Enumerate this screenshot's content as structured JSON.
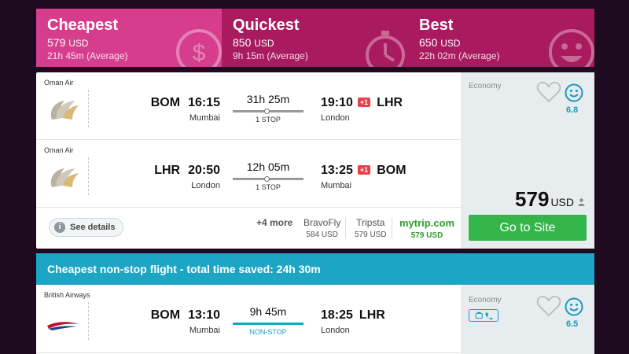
{
  "tabs": [
    {
      "title": "Cheapest",
      "price": "579",
      "currency": "USD",
      "avg": "21h 45m (Average)"
    },
    {
      "title": "Quickest",
      "price": "850",
      "currency": "USD",
      "avg": "9h 15m (Average)"
    },
    {
      "title": "Best",
      "price": "650",
      "currency": "USD",
      "avg": "22h 02m (Average)"
    }
  ],
  "result1": {
    "legs": [
      {
        "airline": "Oman Air",
        "dep_code": "BOM",
        "dep_time": "16:15",
        "dep_city": "Mumbai",
        "duration": "31h 25m",
        "stops": "1 STOP",
        "arr_time": "19:10",
        "day_offset": "+1",
        "arr_code": "LHR",
        "arr_city": "London"
      },
      {
        "airline": "Oman Air",
        "dep_code": "LHR",
        "dep_time": "20:50",
        "dep_city": "London",
        "duration": "12h 05m",
        "stops": "1 STOP",
        "arr_time": "13:25",
        "day_offset": "+1",
        "arr_code": "BOM",
        "arr_city": "Mumbai"
      }
    ],
    "see_details": "See details",
    "more": "+4 more",
    "providers": [
      {
        "name": "BravoFly",
        "price": "584 USD"
      },
      {
        "name": "Tripsta",
        "price": "579 USD"
      },
      {
        "name": "mytrip.com",
        "price": "579 USD"
      }
    ],
    "cabin": "Economy",
    "score": "6.8",
    "price": "579",
    "currency": "USD",
    "cta": "Go to Site"
  },
  "banner": "Cheapest non-stop flight - total time saved: 24h 30m",
  "result2": {
    "airline": "British Airways",
    "dep_code": "BOM",
    "dep_time": "13:10",
    "dep_city": "Mumbai",
    "duration": "9h 45m",
    "stops": "NON-STOP",
    "arr_time": "18:25",
    "arr_code": "LHR",
    "arr_city": "London",
    "cabin": "Economy",
    "score": "6.5"
  },
  "colors": {
    "tab_active": "#d63e8d",
    "tab_inactive": "#a91a5e",
    "cta": "#33b54a",
    "banner": "#1da5c5",
    "badge": "#e8404a"
  }
}
